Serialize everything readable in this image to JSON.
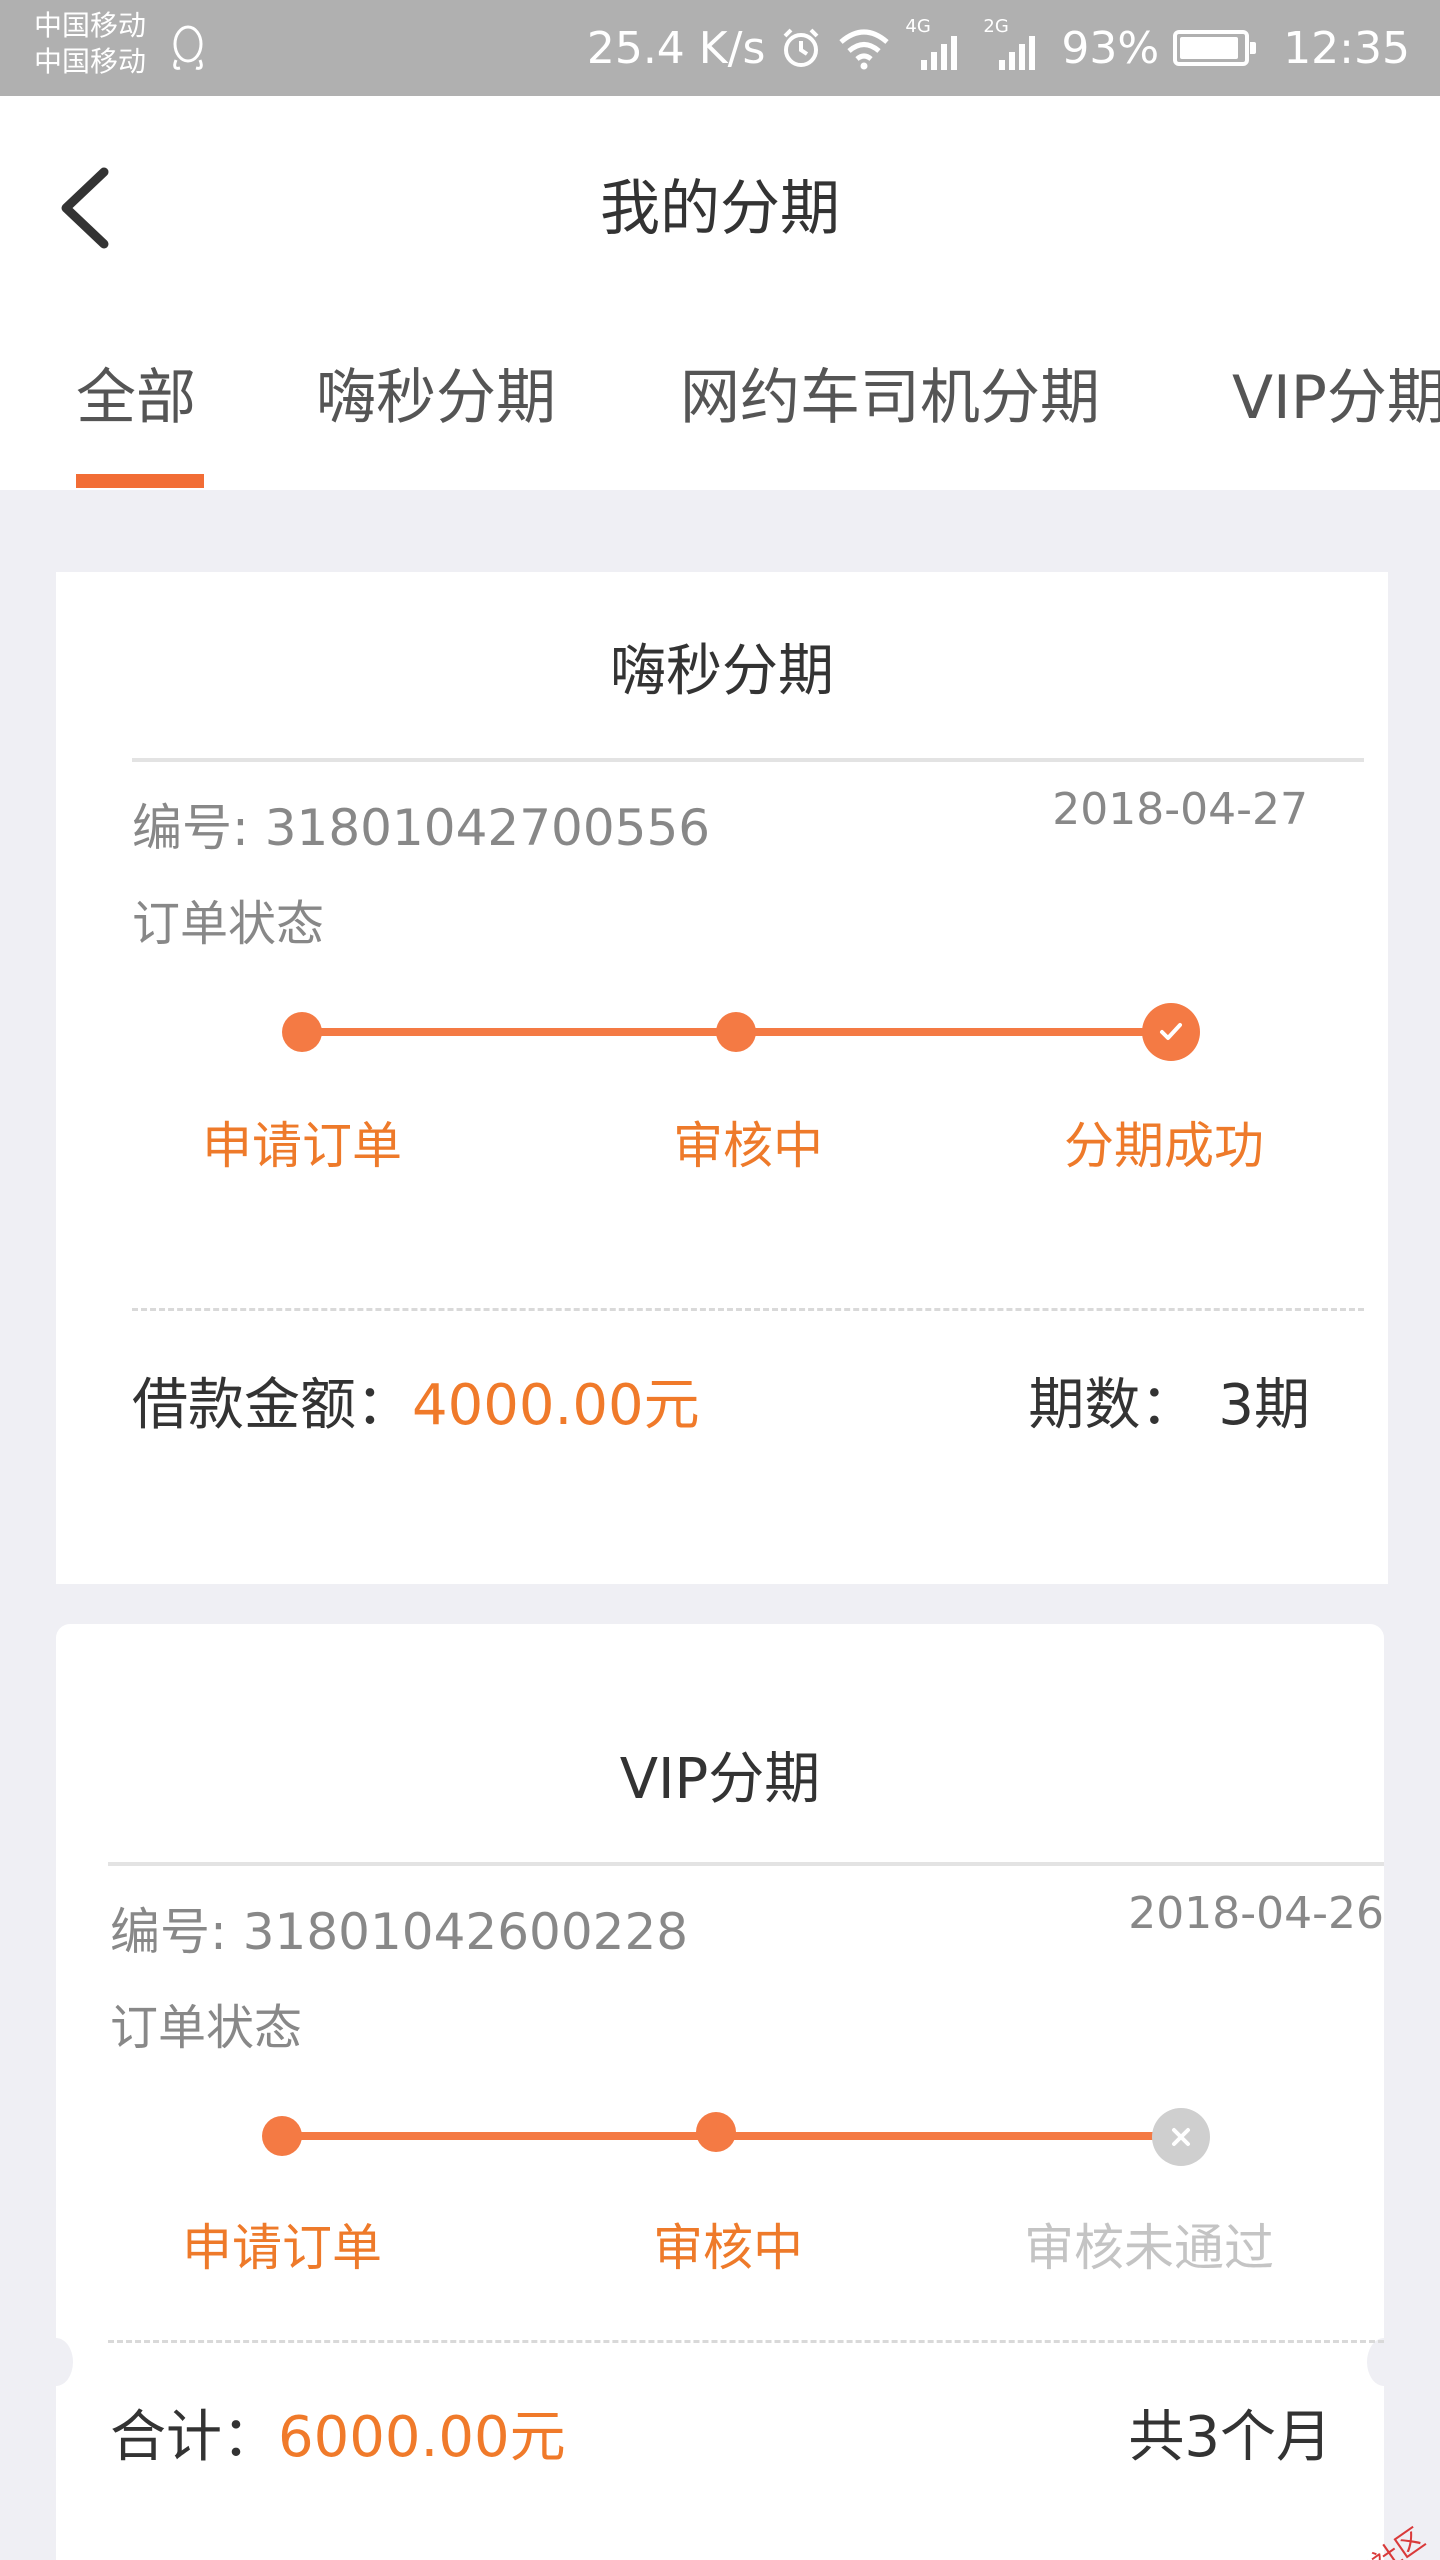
{
  "status_bar": {
    "carrier_1": "中国移动",
    "carrier_2": "中国移动",
    "net_speed": "25.4 K/s",
    "network_1": "4G",
    "network_2": "2G",
    "battery": "93%",
    "time": "12:35",
    "icons": [
      "qq-icon",
      "alarm-icon",
      "wifi-icon",
      "signal-icon",
      "battery-icon"
    ]
  },
  "header": {
    "title": "我的分期",
    "back_icon": "chevron-left-icon"
  },
  "tabs": [
    {
      "label": "全部",
      "active": true
    },
    {
      "label": "嗨秒分期",
      "active": false
    },
    {
      "label": "网约车司机分期",
      "active": false
    },
    {
      "label": "VIP分期",
      "active": false
    }
  ],
  "colors": {
    "accent": "#f47a44",
    "accent_text": "#ee7a2a",
    "muted": "#c4c4c4",
    "background": "#efeff4"
  },
  "orders": [
    {
      "title": "嗨秒分期",
      "number": "编号: 31801042700556",
      "date": "2018-04-27",
      "status_label": "订单状态",
      "steps": [
        {
          "label": "申请订单",
          "state": "done"
        },
        {
          "label": "审核中",
          "state": "done"
        },
        {
          "label": "分期成功",
          "state": "success"
        }
      ],
      "amount_label": "借款金额：",
      "amount_value": "4000.00元",
      "period_label": "期数：",
      "period_value": "3期"
    },
    {
      "title": "VIP分期",
      "number": "编号: 31801042600228",
      "date": "2018-04-26",
      "status_label": "订单状态",
      "steps": [
        {
          "label": "申请订单",
          "state": "done"
        },
        {
          "label": "审核中",
          "state": "done"
        },
        {
          "label": "审核未通过",
          "state": "failed"
        }
      ],
      "amount_label": "合计：",
      "amount_value": "6000.00元",
      "period_text": "共3个月"
    }
  ],
  "watermark": "卡农社区"
}
